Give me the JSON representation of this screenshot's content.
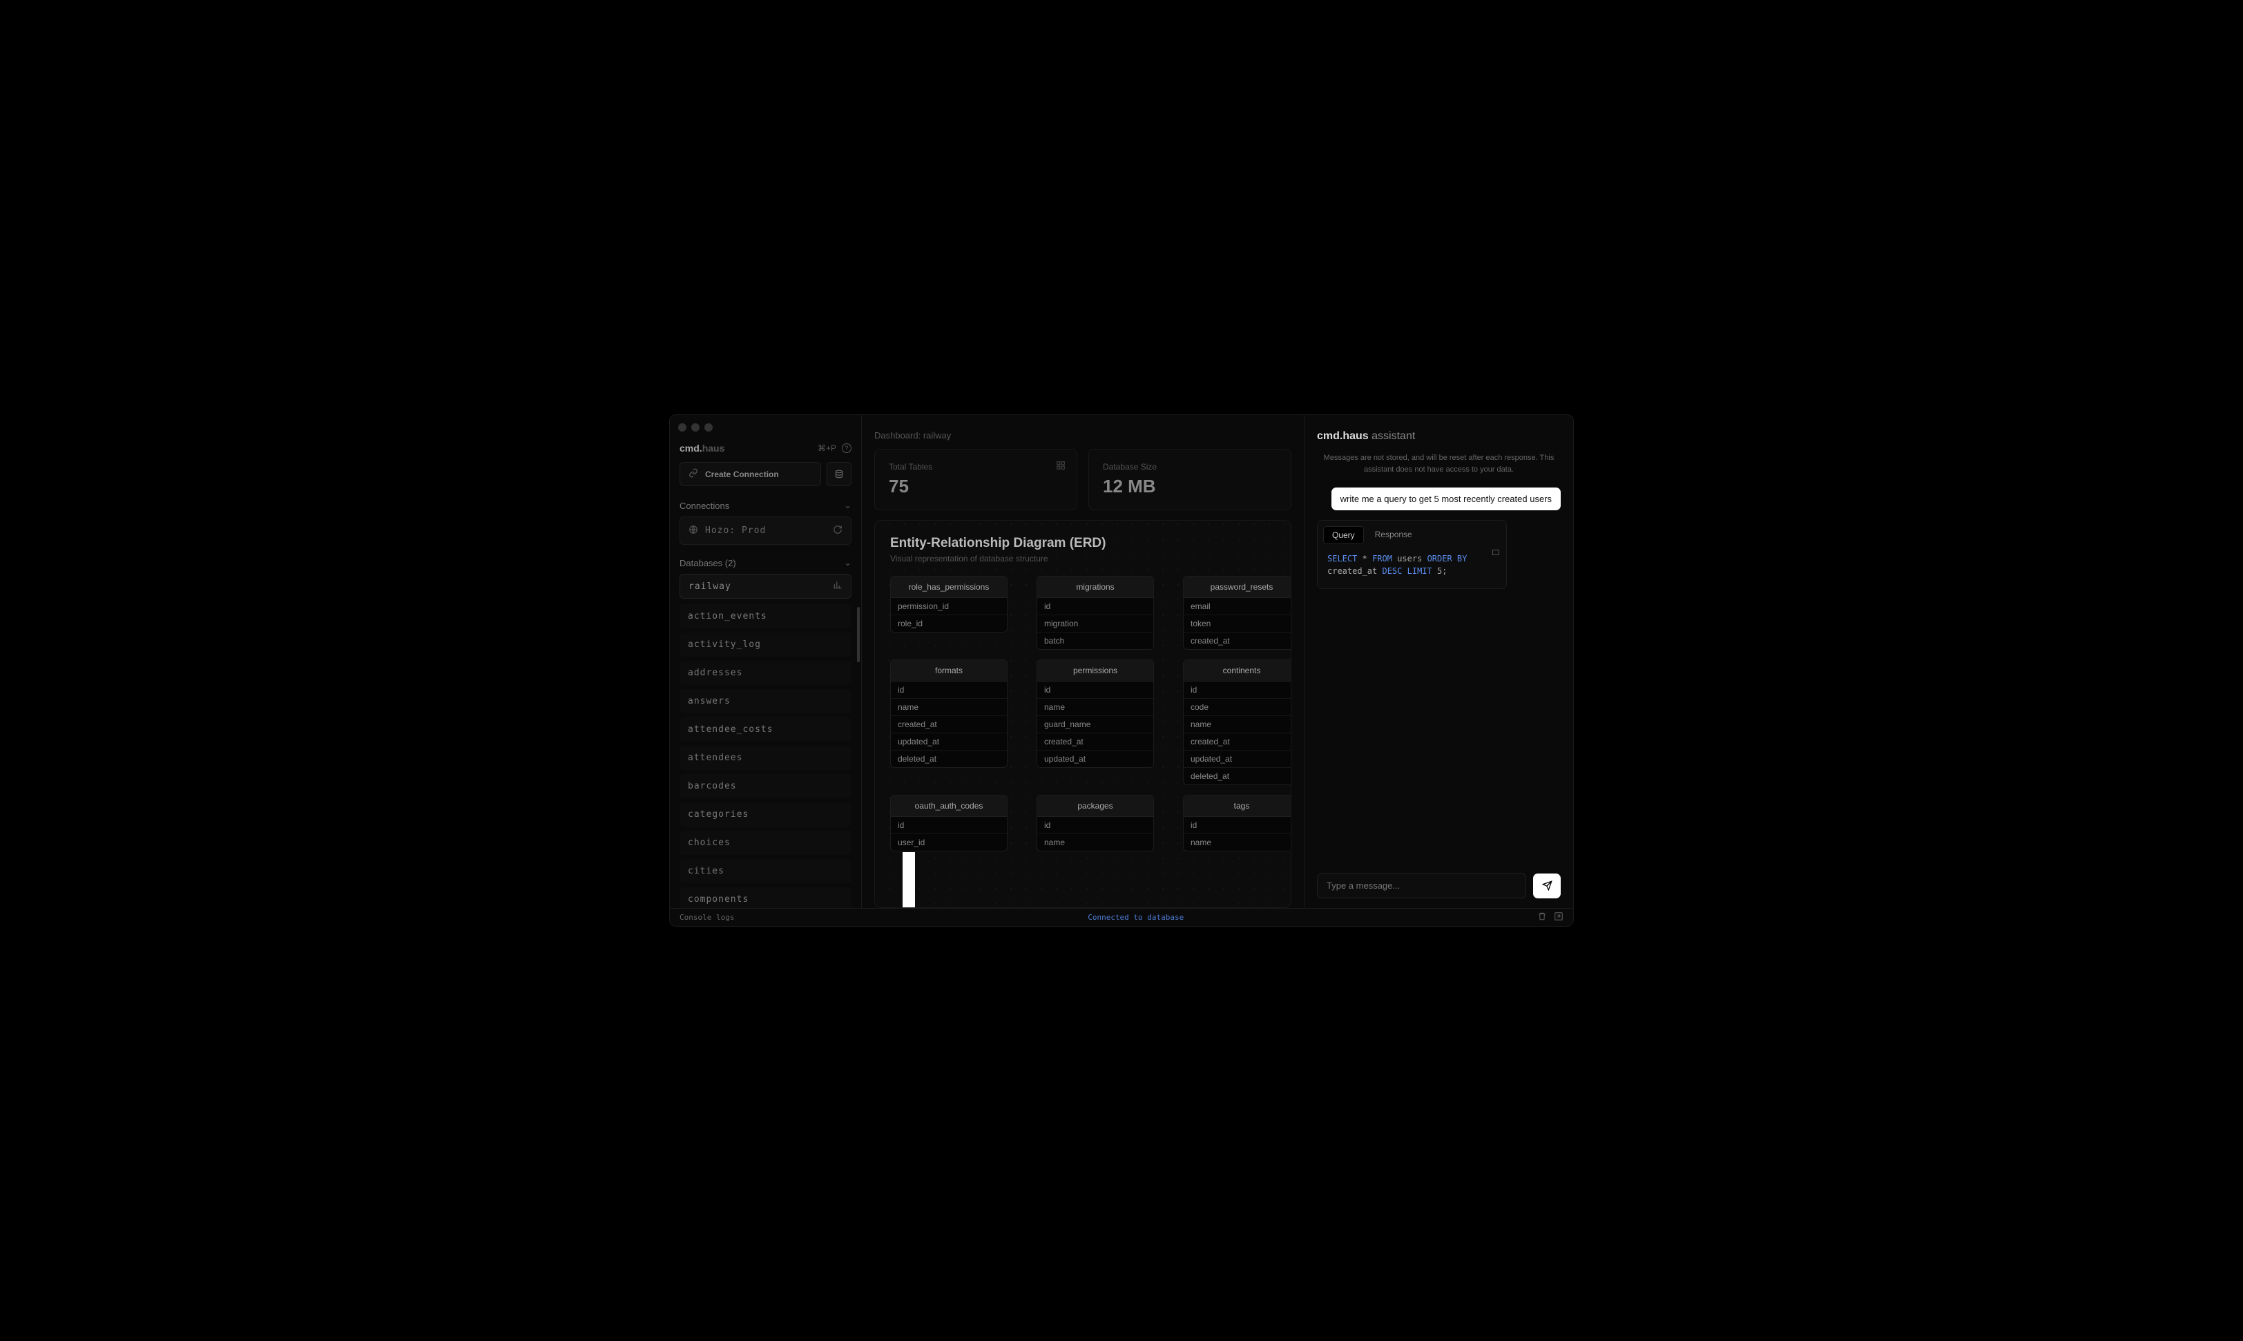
{
  "brand": {
    "cmd": "cmd.",
    "haus": "haus"
  },
  "shortcut": "⌘+P",
  "create_connection": "Create Connection",
  "sections": {
    "connections": "Connections",
    "databases_label": "Databases (2)"
  },
  "connection": {
    "name": "Hozo: Prod"
  },
  "active_db": "railway",
  "tables": [
    "action_events",
    "activity_log",
    "addresses",
    "answers",
    "attendee_costs",
    "attendees",
    "barcodes",
    "categories",
    "choices",
    "cities",
    "components"
  ],
  "breadcrumb": "Dashboard: railway",
  "stats": {
    "total_tables": {
      "label": "Total Tables",
      "value": "75"
    },
    "db_size": {
      "label": "Database Size",
      "value": "12 MB"
    }
  },
  "erd": {
    "title": "Entity-Relationship Diagram (ERD)",
    "subtitle": "Visual representation of database structure",
    "tables": [
      {
        "name": "role_has_permissions",
        "cols": [
          "permission_id",
          "role_id"
        ]
      },
      {
        "name": "migrations",
        "cols": [
          "id",
          "migration",
          "batch"
        ]
      },
      {
        "name": "password_resets",
        "cols": [
          "email",
          "token",
          "created_at"
        ]
      },
      {
        "name": "formats",
        "cols": [
          "id",
          "name",
          "created_at",
          "updated_at",
          "deleted_at"
        ]
      },
      {
        "name": "permissions",
        "cols": [
          "id",
          "name",
          "guard_name",
          "created_at",
          "updated_at"
        ]
      },
      {
        "name": "continents",
        "cols": [
          "id",
          "code",
          "name",
          "created_at",
          "updated_at",
          "deleted_at"
        ]
      },
      {
        "name": "oauth_auth_codes",
        "cols": [
          "id",
          "user_id"
        ]
      },
      {
        "name": "packages",
        "cols": [
          "id",
          "name"
        ]
      },
      {
        "name": "tags",
        "cols": [
          "id",
          "name"
        ]
      }
    ]
  },
  "assistant": {
    "title_bold": "cmd.haus",
    "title_thin": "assistant",
    "notice": "Messages are not stored, and will be reset after each response. This assistant does not have access to your data.",
    "user_message": "write me a query to get 5 most recently created users",
    "tabs": {
      "query": "Query",
      "response": "Response"
    },
    "sql": {
      "select": "SELECT",
      "star": "*",
      "from": "FROM",
      "tbl": "users",
      "orderby": "ORDER BY",
      "col": "created_at",
      "desc": "DESC",
      "limit": "LIMIT",
      "n": "5",
      "semi": ";"
    },
    "placeholder": "Type a message..."
  },
  "footer": {
    "left": "Console logs",
    "center": "Connected to database"
  }
}
